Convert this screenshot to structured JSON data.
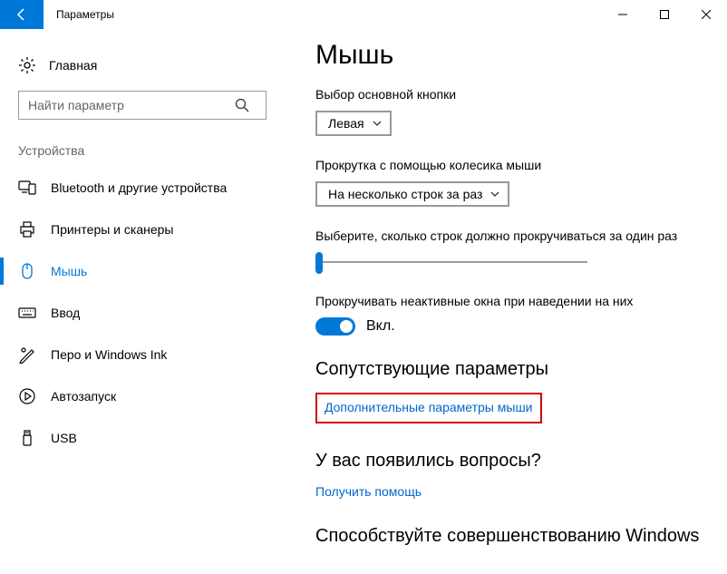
{
  "window": {
    "title": "Параметры"
  },
  "sidebar": {
    "home": "Главная",
    "search_placeholder": "Найти параметр",
    "group": "Устройства",
    "items": [
      {
        "label": "Bluetooth и другие устройства"
      },
      {
        "label": "Принтеры и сканеры"
      },
      {
        "label": "Мышь"
      },
      {
        "label": "Ввод"
      },
      {
        "label": "Перо и Windows Ink"
      },
      {
        "label": "Автозапуск"
      },
      {
        "label": "USB"
      }
    ]
  },
  "main": {
    "title": "Мышь",
    "primary_label": "Выбор основной кнопки",
    "primary_value": "Левая",
    "scroll_label": "Прокрутка с помощью колесика мыши",
    "scroll_value": "На несколько строк за раз",
    "lines_label": "Выберите, сколько строк должно прокручиваться за один раз",
    "inactive_label": "Прокручивать неактивные окна при наведении на них",
    "toggle_text": "Вкл.",
    "related_hdr": "Сопутствующие параметры",
    "related_link": "Дополнительные параметры мыши",
    "help_hdr": "У вас появились вопросы?",
    "help_link": "Получить помощь",
    "improve_hdr": "Способствуйте совершенствованию Windows"
  }
}
